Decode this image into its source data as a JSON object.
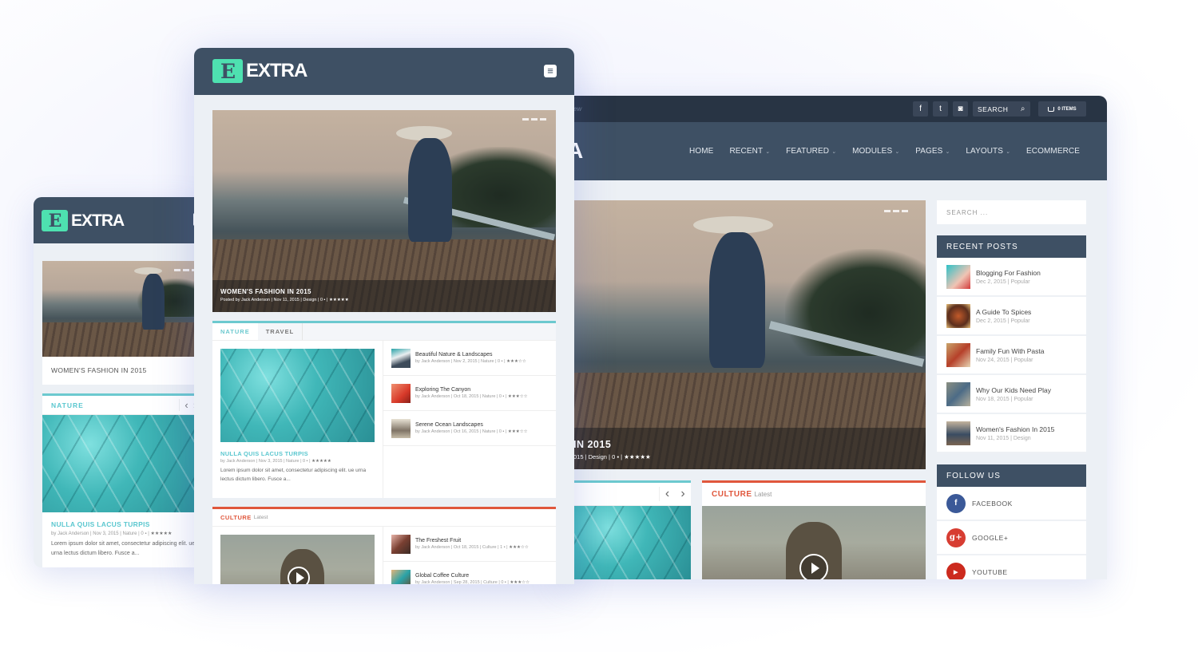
{
  "brand": {
    "name": "EXTRA",
    "logo_letter": "E"
  },
  "colors": {
    "header": "#3e5064",
    "topbar": "#283444",
    "logo_accent": "#4ee1b0",
    "teal": "#6cc9cf",
    "culture_red": "#e0573c",
    "facebook": "#3b5998",
    "googleplus": "#d73d32",
    "youtube": "#cc2a1e"
  },
  "desktop": {
    "topbar": {
      "left_text": "ew",
      "social_icons": [
        "facebook-icon",
        "twitter-icon",
        "instagram-icon"
      ],
      "social_glyphs": [
        "f",
        "t",
        "◙"
      ],
      "search_label": "SEARCH",
      "search_glyph": "⌕",
      "cart_glyph": "🛒",
      "cart_label": "0 ITEMS"
    },
    "logo_fragment": "A",
    "nav": [
      {
        "label": "HOME",
        "dropdown": false
      },
      {
        "label": "RECENT",
        "dropdown": true
      },
      {
        "label": "FEATURED",
        "dropdown": true
      },
      {
        "label": "MODULES",
        "dropdown": true
      },
      {
        "label": "PAGES",
        "dropdown": true
      },
      {
        "label": "LAYOUTS",
        "dropdown": true
      },
      {
        "label": "ECOMMERCE",
        "dropdown": false
      }
    ],
    "chevron": "⌄",
    "hero": {
      "title_fragment": "IN 2015",
      "meta_fragment": "015 | Design | 0",
      "comment_glyph": "💬",
      "rating": 2.5,
      "stars": "★★★★★"
    },
    "nature_slider": {
      "prev": "‹",
      "next": "›"
    },
    "culture": {
      "title": "CULTURE",
      "subtitle": "Latest"
    },
    "sidebar": {
      "search_placeholder": "SEARCH ...",
      "recent_posts_title": "RECENT POSTS",
      "recent_posts": [
        {
          "title": "Blogging For Fashion",
          "date": "Dec 2, 2015",
          "category": "Popular",
          "thumb": "linear-gradient(135deg,#2ec1c7,#f0c4b4 60%,#d23b3b)"
        },
        {
          "title": "A Guide To Spices",
          "date": "Dec 2, 2015",
          "category": "Popular",
          "thumb": "radial-gradient(circle,#c25a2a,#5b2e1d 60%,#e8c07a)"
        },
        {
          "title": "Family Fun With Pasta",
          "date": "Nov 24, 2015",
          "category": "Popular",
          "thumb": "linear-gradient(135deg,#c9a46b,#b6402a 50%,#e7d6b4)"
        },
        {
          "title": "Why Our Kids Need Play",
          "date": "Nov 18, 2015",
          "category": "Popular",
          "thumb": "linear-gradient(135deg,#8b8f82,#4c6b86 50%,#b6b09c)"
        },
        {
          "title": "Women's Fashion In 2015",
          "date": "Nov 11, 2015",
          "category": "Design",
          "thumb": "linear-gradient(180deg,#c3b39d,#3a4c62 55%,#7a6551)"
        }
      ],
      "follow_title": "FOLLOW US",
      "follow": [
        {
          "label": "FACEBOOK",
          "glyph": "f",
          "icon": "facebook-icon"
        },
        {
          "label": "GOOGLE+",
          "glyph": "g+",
          "icon": "google-plus-icon"
        },
        {
          "label": "YOUTUBE",
          "glyph": "▶",
          "icon": "youtube-icon"
        }
      ]
    }
  },
  "tablet": {
    "menu_glyph": "≡",
    "hero": {
      "title": "WOMEN'S FASHION IN 2015",
      "meta": "Posted by Jack Anderson | Nov 11, 2015 | Design | 0",
      "rating": 2.5,
      "stars": "★★★★★"
    },
    "tabs": [
      {
        "label": "NATURE",
        "active": true
      },
      {
        "label": "TRAVEL",
        "active": false
      }
    ],
    "featured": {
      "title": "NULLA QUIS LACUS TURPIS",
      "meta": "by Jack Anderson | Nov 3, 2015 | Nature | 0",
      "rating": 3.5,
      "excerpt": "Lorem ipsum dolor sit amet, consectetur adipiscing elit. ue urna lectus dictum libero. Fusce a..."
    },
    "nature_list": [
      {
        "title": "Beautiful Nature & Landscapes",
        "meta": "by Jack Anderson | Nov 2, 2015 | Nature | 0",
        "rating": 2.5,
        "thumb": "linear-gradient(160deg,#2aa3a8,#e9eef0 40%,#3d4b5a 70%)"
      },
      {
        "title": "Exploring The Canyon",
        "meta": "by Jack Anderson | Oct 18, 2015 | Nature | 0",
        "rating": 3,
        "thumb": "linear-gradient(135deg,#f09070,#d83a2a 60%,#8a2018)"
      },
      {
        "title": "Serene Ocean Landscapes",
        "meta": "by Jack Anderson | Oct 16, 2015 | Nature | 0",
        "rating": 2.5,
        "thumb": "linear-gradient(180deg,#e8e2d4,#7f7466 60%,#c6bca8)"
      }
    ],
    "culture": {
      "title": "CULTURE",
      "subtitle": "Latest"
    },
    "culture_list": [
      {
        "title": "The Freshest Fruit",
        "meta": "by Jack Anderson | Oct 18, 2015 | Culture | 1",
        "rating": 2.5,
        "thumb": "linear-gradient(135deg,#e7b3a8,#7a4032 50%,#3b2b26)"
      },
      {
        "title": "Global Coffee Culture",
        "meta": "by Jack Anderson | Sep 28, 2015 | Culture | 0",
        "rating": 3,
        "thumb": "linear-gradient(135deg,#e4b47a,#2aa3a8 50%,#6b4a2c)"
      }
    ]
  },
  "mobile": {
    "hero_title": "WOMEN'S FASHION IN 2015",
    "nature_title": "NATURE",
    "slider_prev": "‹",
    "slider_next": "›",
    "featured": {
      "title": "NULLA QUIS LACUS TURPIS",
      "meta": "by Jack Anderson | Nov 3, 2015 | Nature | 0",
      "rating": 3.5,
      "excerpt": "Lorem ipsum dolor sit amet, consectetur adipiscing elit. ue urna lectus dictum libero. Fusce a..."
    }
  }
}
